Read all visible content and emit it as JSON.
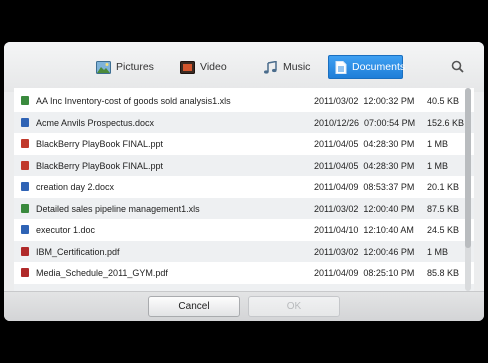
{
  "tabs": [
    {
      "label": "Pictures",
      "icon": "pictures-icon"
    },
    {
      "label": "Video",
      "icon": "video-icon"
    },
    {
      "label": "Music",
      "icon": "music-icon"
    },
    {
      "label": "Documents",
      "icon": "documents-icon",
      "active": true
    }
  ],
  "files": [
    {
      "name": "AA Inc Inventory-cost of goods sold analysis1.xls",
      "date": "2011/03/02  12:00:32 PM",
      "size": "40.5 KB",
      "type": "xls"
    },
    {
      "name": "Acme Anvils Prospectus.docx",
      "date": "2010/12/26  07:00:54 PM",
      "size": "152.6 KB",
      "type": "doc"
    },
    {
      "name": "BlackBerry PlayBook FINAL.ppt",
      "date": "2011/04/05  04:28:30 PM",
      "size": "1 MB",
      "type": "ppt"
    },
    {
      "name": "BlackBerry PlayBook FINAL.ppt",
      "date": "2011/04/05  04:28:30 PM",
      "size": "1 MB",
      "type": "ppt"
    },
    {
      "name": "creation day 2.docx",
      "date": "2011/04/09  08:53:37 PM",
      "size": "20.1 KB",
      "type": "doc"
    },
    {
      "name": "Detailed sales pipeline management1.xls",
      "date": "2011/03/02  12:00:40 PM",
      "size": "87.5 KB",
      "type": "xls"
    },
    {
      "name": "executor 1.doc",
      "date": "2011/04/10  12:10:40 AM",
      "size": "24.5 KB",
      "type": "doc"
    },
    {
      "name": "IBM_Certification.pdf",
      "date": "2011/03/02  12:00:46 PM",
      "size": "1 MB",
      "type": "pdf"
    },
    {
      "name": "Media_Schedule_2011_GYM.pdf",
      "date": "2011/04/09  08:25:10 PM",
      "size": "85.8 KB",
      "type": "pdf"
    }
  ],
  "buttons": {
    "cancel": "Cancel",
    "ok": "OK"
  },
  "colors": {
    "accent": "#2a88e0",
    "xls": "#3a8a3e",
    "doc": "#2f63b5",
    "ppt": "#c0392b",
    "pdf": "#b02a2a"
  }
}
